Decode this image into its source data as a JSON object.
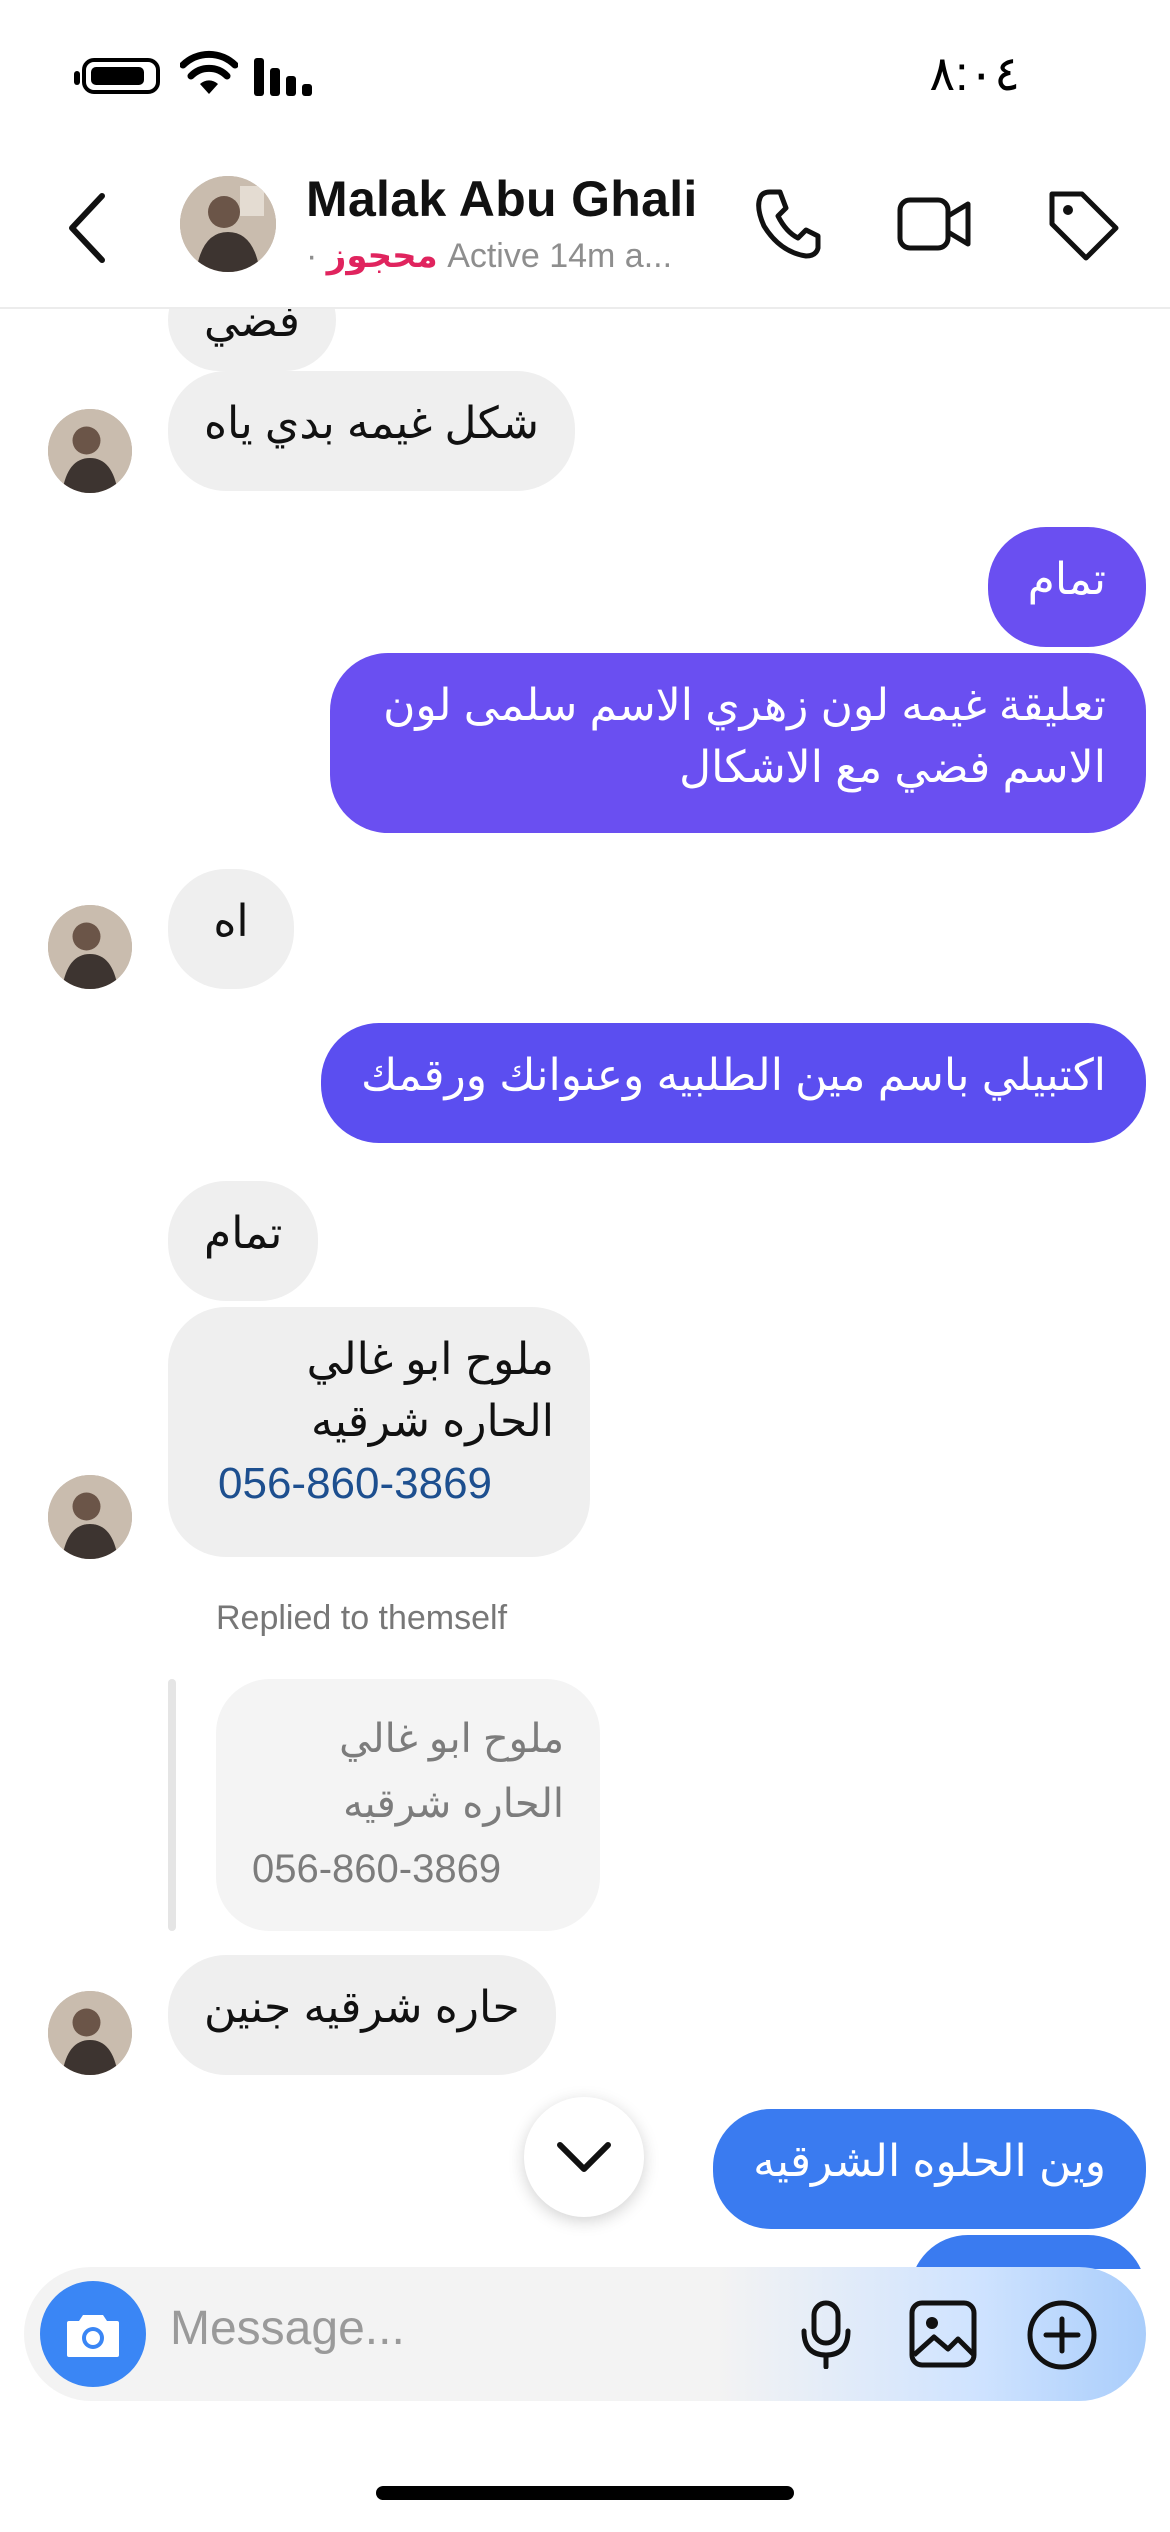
{
  "status_bar": {
    "time": "٨:٠٤",
    "icons": [
      "battery-icon",
      "wifi-icon",
      "signal-icon"
    ]
  },
  "header": {
    "name": "Malak Abu Ghali",
    "dot": "·",
    "badge": "محجوز",
    "activity": "Active 14m a...",
    "icons": [
      "back-icon",
      "phone-icon",
      "video-icon",
      "tag-icon"
    ]
  },
  "messages": [
    {
      "side": "in",
      "text": "فضي"
    },
    {
      "side": "in",
      "text": "شكل غيمه بدي ياه"
    },
    {
      "side": "out",
      "text": "تمام"
    },
    {
      "side": "out",
      "text": "تعليقة غيمه لون زهري الاسم سلمى لون الاسم فضي مع الاشكال"
    },
    {
      "side": "in",
      "text": "اه"
    },
    {
      "side": "out",
      "text": "اكتبيلي باسم مين الطلبيه وعنوانك ورقمك"
    },
    {
      "side": "in",
      "text": "تمام"
    },
    {
      "side": "in",
      "lines": [
        "ملوح ابو غالي",
        "الحاره شرقيه"
      ],
      "phone": "056-860-3869"
    },
    {
      "side": "in",
      "text": "حاره شرقيه جنين"
    },
    {
      "side": "out",
      "text": "وين الحلوه الشرقيه"
    }
  ],
  "reply": {
    "note": "Replied to themself",
    "lines": [
      "ملوح ابو غالي",
      "الحاره شرقيه"
    ],
    "phone": "056-860-3869"
  },
  "composer": {
    "placeholder": "Message...",
    "icons": [
      "camera-icon",
      "mic-icon",
      "gallery-icon",
      "plus-icon"
    ]
  },
  "colors": {
    "outgoing_purple": "#6a4ff1",
    "outgoing_blue": "#3a7bf0",
    "incoming": "#efefef",
    "badge": "#e0245e"
  }
}
